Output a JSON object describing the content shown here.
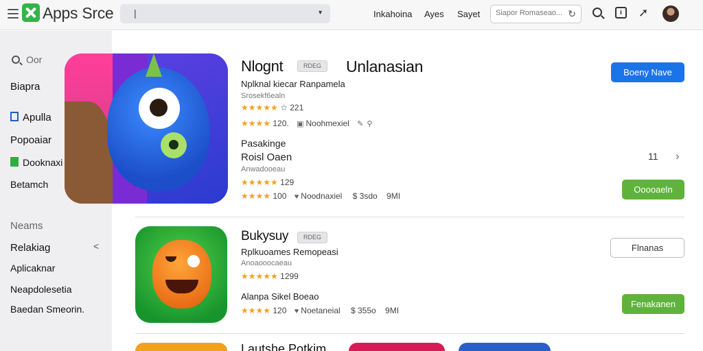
{
  "topbar": {
    "app_name": "Apps Srce",
    "search_value": "|",
    "nav": [
      "Inkahoina",
      "Ayes",
      "Sayet"
    ],
    "filter_placeholder": "Siapor Romaseao...",
    "icons": [
      "menu-icon",
      "logo-icon",
      "dropdown-icon",
      "refresh-icon",
      "search-icon",
      "inbox-icon",
      "share-icon",
      "avatar"
    ]
  },
  "sidebar": {
    "search_label": "Oor",
    "items": [
      "Biapra",
      "Apulla",
      "Popoaiar",
      "Dooknaxi",
      "Betamch"
    ],
    "section_label": "Neams",
    "section_items": [
      "Relakiag",
      "Aplicaknar",
      "Neapdolesetia",
      "Baedan Smeorin."
    ]
  },
  "featured": {
    "title": "Nlognt",
    "badge": "RDEG",
    "developer_heading": "Unlanasian",
    "category": "Nplknal kiecar Ranpamela",
    "subtitle": "Srosekf6ealn",
    "rating1_text": "☆ 221",
    "rating2_text": "120.",
    "rating2_label": "Noohmexiel",
    "primary_button": "Boeny Nave",
    "second_heading": "Pasakinge",
    "second_name": "Roisl Oaen",
    "second_sub": "Anwadooeau",
    "second_rating": "129",
    "second_meta_num": "100",
    "second_meta_label": "Noodnaxiel",
    "second_price": "$ 3sdo",
    "second_size": "9MI",
    "second_button": "Ooooaeln",
    "pager_number": "11"
  },
  "app2": {
    "title": "Bukysuy",
    "badge": "RDEG",
    "category": "Rplkuoames Remopeasi",
    "subtitle": "Anoaooocaeau",
    "rating": "1299",
    "subheading": "Alanpa Sikel Boeao",
    "meta_num": "120",
    "meta_label": "Noetaneial",
    "price": "$ 355o",
    "size": "9MI",
    "outline_button": "Flnanas",
    "green_button": "Fenakanen"
  },
  "peek": {
    "title": "Lautshe Potkim"
  }
}
